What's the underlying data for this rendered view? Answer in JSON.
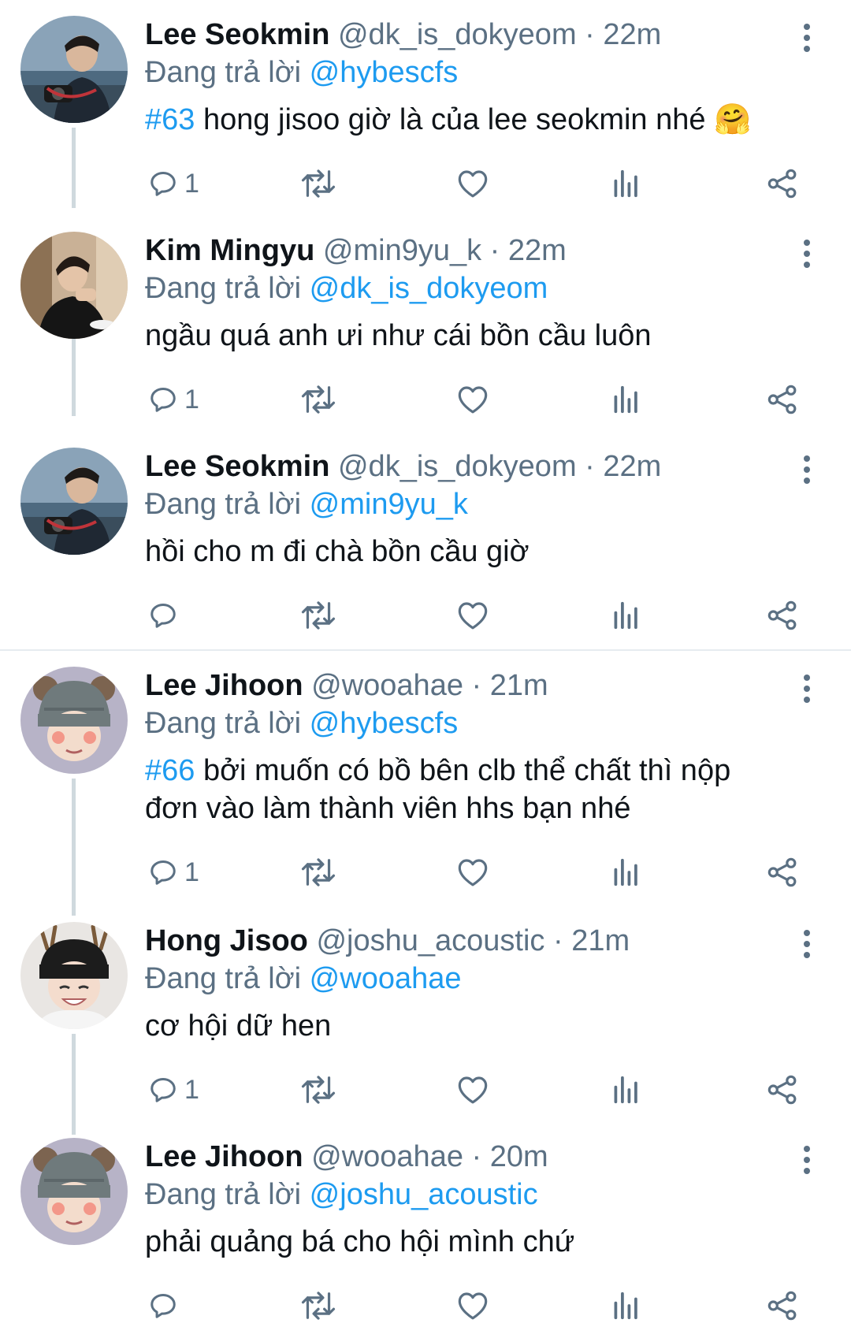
{
  "ui": {
    "replying_label": "Đang trả lời",
    "colors": {
      "accent": "#1d9bf0",
      "secondary_text": "#5b7083",
      "thread_line": "#cfd9de"
    }
  },
  "tweets": [
    {
      "name": "Lee Seokmin",
      "handle": "@dk_is_dokyeom",
      "time": "· 22m",
      "reply_to": "@hybescfs",
      "hashtag": "#63",
      "text": " hong jisoo giờ là của lee seokmin nhé 🤗",
      "reply_count": "1"
    },
    {
      "name": "Kim Mingyu",
      "handle": "@min9yu_k",
      "time": "· 22m",
      "reply_to": "@dk_is_dokyeom",
      "hashtag": "",
      "text": "ngầu quá anh ưi như cái bồn cầu luôn",
      "reply_count": "1"
    },
    {
      "name": "Lee Seokmin",
      "handle": "@dk_is_dokyeom",
      "time": "· 22m",
      "reply_to": "@min9yu_k",
      "hashtag": "",
      "text": "hồi cho m đi chà bồn cầu giờ",
      "reply_count": ""
    },
    {
      "name": "Lee Jihoon",
      "handle": "@wooahae",
      "time": "· 21m",
      "reply_to": "@hybescfs",
      "hashtag": "#66",
      "text": " bởi muốn có bồ bên clb thể chất thì nộp đơn vào làm thành viên hhs bạn nhé",
      "reply_count": "1"
    },
    {
      "name": "Hong Jisoo",
      "handle": "@joshu_acoustic",
      "time": "· 21m",
      "reply_to": "@wooahae",
      "hashtag": "",
      "text": "cơ hội dữ hen",
      "reply_count": "1"
    },
    {
      "name": "Lee Jihoon",
      "handle": "@wooahae",
      "time": "· 20m",
      "reply_to": "@joshu_acoustic",
      "hashtag": "",
      "text": "phải quảng bá cho hội mình chứ",
      "reply_count": ""
    }
  ]
}
